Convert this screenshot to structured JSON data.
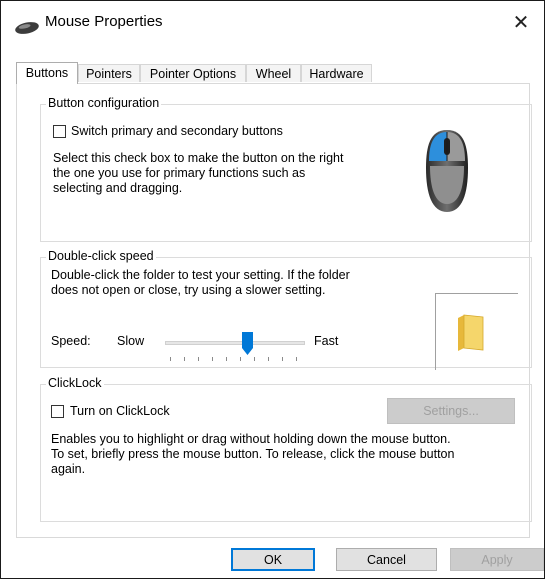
{
  "window": {
    "title": "Mouse Properties",
    "close_glyph": "✕"
  },
  "tabs": [
    {
      "label": "Buttons",
      "active": true
    },
    {
      "label": "Pointers",
      "active": false
    },
    {
      "label": "Pointer Options",
      "active": false
    },
    {
      "label": "Wheel",
      "active": false
    },
    {
      "label": "Hardware",
      "active": false
    }
  ],
  "button_config": {
    "legend": "Button configuration",
    "checkbox_label": "Switch primary and secondary buttons",
    "checked": false,
    "description": "Select this check box to make the button on the right the one you use for primary functions such as selecting and dragging.",
    "desc_lines": [
      "Select this check box to make the button on the right",
      "the one you use for primary functions such as",
      "selecting and dragging."
    ]
  },
  "double_click": {
    "legend": "Double-click speed",
    "desc_lines": [
      "Double-click the folder to test your setting. If the folder",
      "does not open or close, try using a slower setting."
    ],
    "speed_label": "Speed:",
    "slow_label": "Slow",
    "fast_label": "Fast",
    "speed_value_fraction": 0.59
  },
  "clicklock": {
    "legend": "ClickLock",
    "checkbox_label": "Turn on ClickLock",
    "checked": false,
    "settings_button": "Settings...",
    "desc_lines": [
      "Enables you to highlight or drag without holding down the mouse button.",
      "To set, briefly press the mouse button. To release, click the mouse button",
      "again."
    ]
  },
  "footer": {
    "ok": "OK",
    "cancel": "Cancel",
    "apply": "Apply"
  },
  "colors": {
    "accent": "#0078d7",
    "folder": "#f5d66b"
  }
}
